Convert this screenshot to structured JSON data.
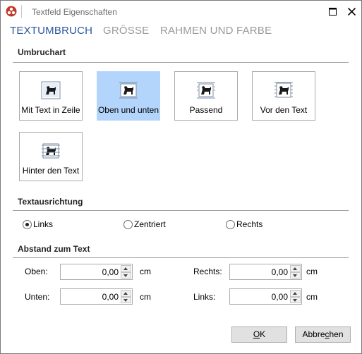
{
  "window": {
    "title": "Textfeld Eigenschaften",
    "maximize_icon": "maximize-icon",
    "close_icon": "close-icon"
  },
  "tabs": [
    {
      "label": "TEXTUMBRUCH",
      "active": true
    },
    {
      "label": "GRÖSSE",
      "active": false
    },
    {
      "label": "RAHMEN UND FARBE",
      "active": false
    }
  ],
  "umbruchart": {
    "title": "Umbruchart",
    "options": [
      {
        "label": "Mit Text in Zeile",
        "selected": false
      },
      {
        "label": "Oben und unten",
        "selected": true
      },
      {
        "label": "Passend",
        "selected": false
      },
      {
        "label": "Vor den Text",
        "selected": false
      },
      {
        "label": "Hinter den Text",
        "selected": false
      }
    ]
  },
  "textausrichtung": {
    "title": "Textausrichtung",
    "options": [
      {
        "label": "Links",
        "checked": true
      },
      {
        "label": "Zentriert",
        "checked": false
      },
      {
        "label": "Rechts",
        "checked": false
      }
    ]
  },
  "abstand": {
    "title": "Abstand zum Text",
    "fields": [
      {
        "label": "Oben:",
        "value": "0,00",
        "unit": "cm"
      },
      {
        "label": "Rechts:",
        "value": "0,00",
        "unit": "cm"
      },
      {
        "label": "Unten:",
        "value": "0,00",
        "unit": "cm"
      },
      {
        "label": "Links:",
        "value": "0,00",
        "unit": "cm"
      }
    ]
  },
  "buttons": {
    "ok_underlined": "O",
    "ok_rest": "K",
    "cancel_start": "Abbre",
    "cancel_underlined": "c",
    "cancel_end": "hen"
  },
  "colors": {
    "accent": "#2b579a",
    "selected_bg": "#b3d4fb"
  }
}
